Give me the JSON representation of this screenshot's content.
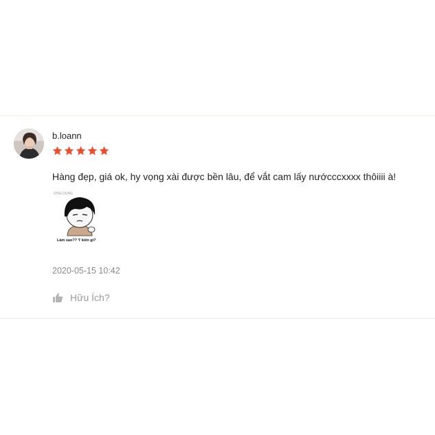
{
  "review": {
    "username": "b.loann",
    "rating": 5,
    "rating_max": 5,
    "star_color": "#ee4d2d",
    "comment": "Hàng đẹp, giá ok, hy vọng xài được bền lâu, để vắt cam lấy nướcccxxxx thôiiii à!",
    "photo": {
      "watermark": "ỨNG DỤNG",
      "caption": "Làm sao?? Ý kiến gì?"
    },
    "timestamp": "2020-05-15 10:42",
    "like_label": "Hữu Ích?"
  },
  "icons": {
    "star": "star-icon",
    "like": "thumbs-up-icon"
  }
}
